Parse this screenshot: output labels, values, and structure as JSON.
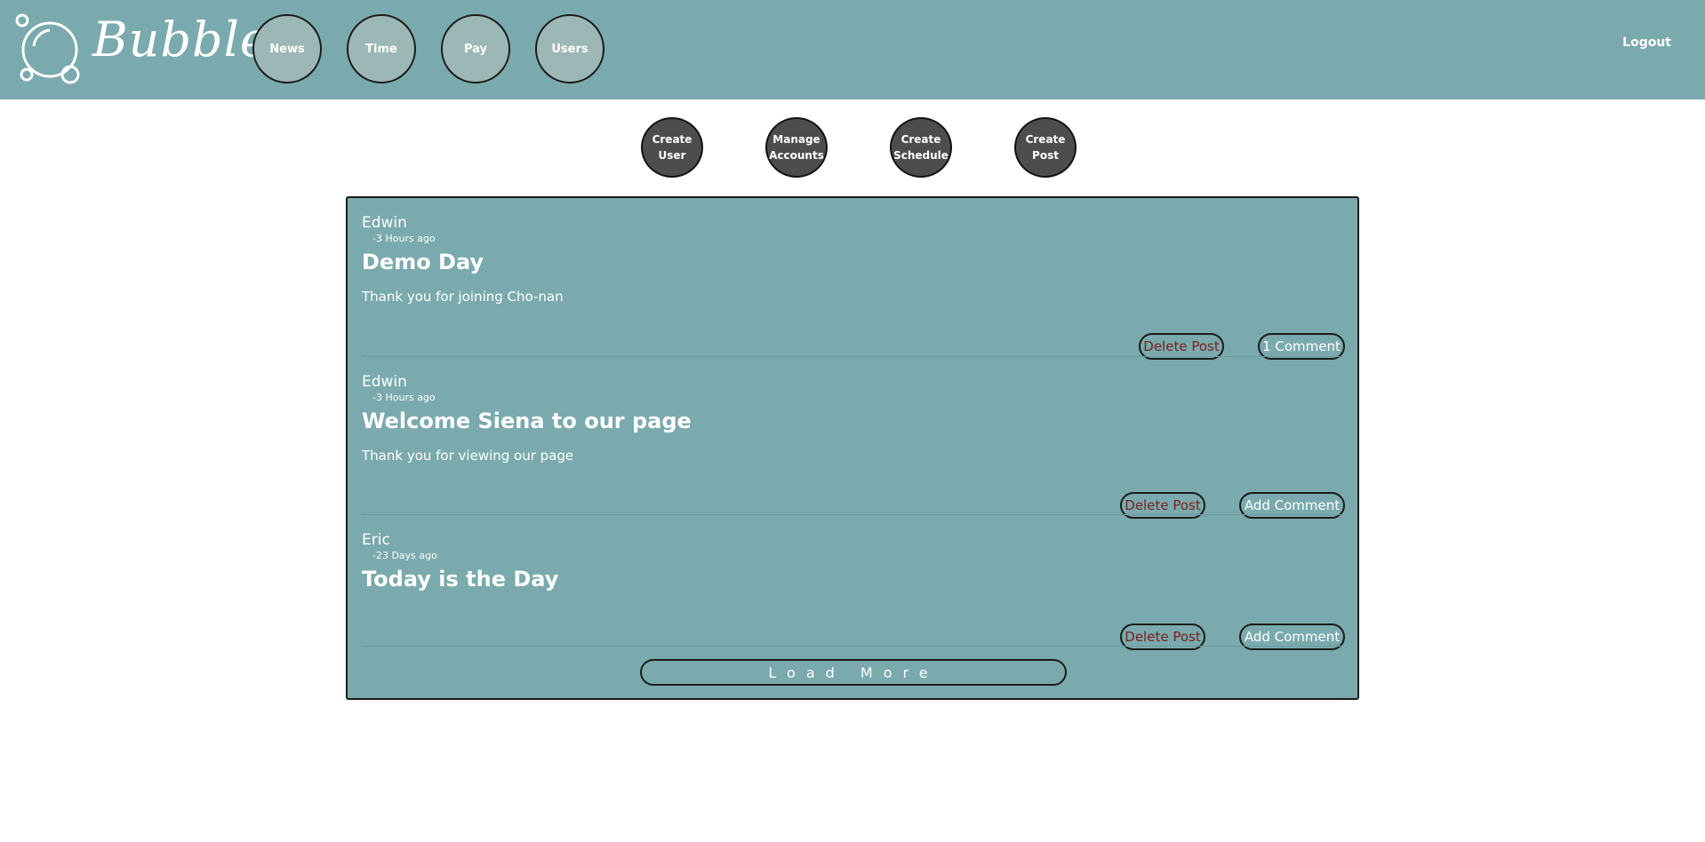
{
  "app": {
    "name": "Bubbles"
  },
  "nav": {
    "items": [
      {
        "label": "News"
      },
      {
        "label": "Time"
      },
      {
        "label": "Pay"
      },
      {
        "label": "Users"
      }
    ],
    "logout": "Logout"
  },
  "admin_actions": [
    {
      "label": "Create\nUser"
    },
    {
      "label": "Manage\nAccounts"
    },
    {
      "label": "Create\nSchedule"
    },
    {
      "label": "Create\nPost"
    }
  ],
  "posts": [
    {
      "author": "Edwin",
      "time": "-3 Hours ago",
      "title": "Demo Day",
      "body": "Thank you for joining Cho-nan",
      "delete_label": "Delete Post",
      "comment_label": "1 Comment"
    },
    {
      "author": "Edwin",
      "time": "-3 Hours ago",
      "title": "Welcome Siena to our page",
      "body": "Thank you for viewing our page",
      "delete_label": "Delete Post",
      "comment_label": "Add Comment"
    },
    {
      "author": "Eric",
      "time": "-23 Days ago",
      "title": "Today is the Day",
      "body": "",
      "delete_label": "Delete Post",
      "comment_label": "Add Comment"
    }
  ],
  "load_more": "Load More",
  "colors": {
    "header_bg": "#7aaaad",
    "nav_circle": "#9cb8b6",
    "admin_button": "#4d4d4d",
    "delete_text": "#7a1f1f"
  }
}
